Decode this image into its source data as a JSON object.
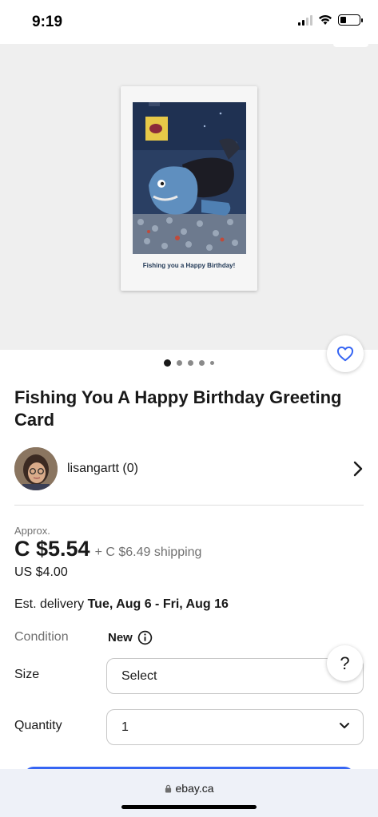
{
  "status_bar": {
    "time": "9:19",
    "battery_level": 0.3
  },
  "listing": {
    "image_caption": "Fishing you a Happy Birthday!",
    "carousel": {
      "count": 5,
      "active": 0
    },
    "title": "Fishing You A Happy Birthday Greeting Card",
    "seller": {
      "name": "lisangartt (0)"
    },
    "approx_label": "Approx.",
    "price": "C $5.54",
    "shipping": "+ C $6.49 shipping",
    "usd_price": "US $4.00",
    "delivery_label": "Est. delivery",
    "delivery_dates": "Tue, Aug 6 - Fri, Aug 16",
    "condition_label": "Condition",
    "condition_value": "New",
    "size_label": "Size",
    "size_value": "Select",
    "quantity_label": "Quantity",
    "quantity_value": "1"
  },
  "help_button": {
    "label": "?"
  },
  "browser": {
    "url": "ebay.ca"
  },
  "icons": {
    "favorite": "heart-icon",
    "seller_chevron": "chevron-right-icon",
    "condition_info": "info-icon",
    "quantity_chevron": "chevron-down-icon",
    "lock": "lock-icon"
  },
  "colors": {
    "accent": "#3665f3",
    "text": "#191919",
    "muted": "#707070"
  }
}
